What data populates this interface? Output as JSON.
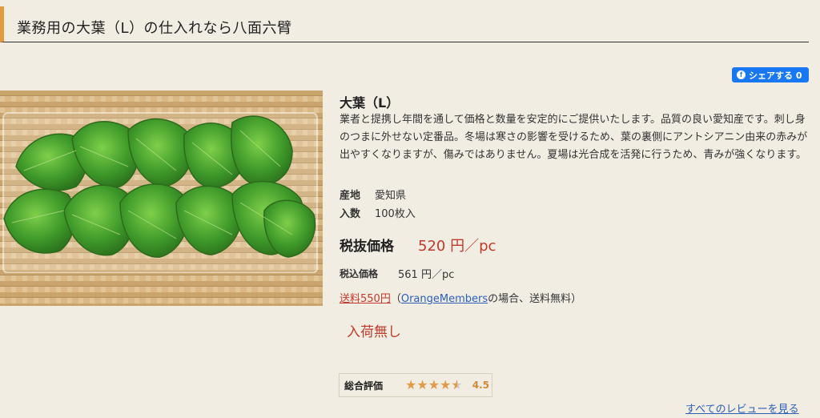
{
  "header": {
    "title": "業務用の大葉（L）の仕入れなら八面六臂"
  },
  "share": {
    "label": "シェアする 0",
    "icon": "facebook-icon",
    "color": "#1877f2"
  },
  "product": {
    "name": "大葉（L）",
    "description": "業者と提携し年間を通して価格と数量を安定的にご提供いたします。品質の良い愛知産です。刺し身のつまに外せない定番品。冬場は寒さの影響を受けるため、葉の裏側にアントシアニン由来の赤みが出やすくなりますが、傷みではありません。夏場は光合成を活発に行うため、青みが強くなります。",
    "origin_label": "産地",
    "origin_value": "愛知県",
    "quantity_label": "入数",
    "quantity_value": "100枚入",
    "price_label": "税抜価格",
    "price_value": "520 円／pc",
    "tax_price_label": "税込価格",
    "tax_price_value": "561 円／pc",
    "shipping_link": "送料550円",
    "shipping_open": "（",
    "members_link": "OrangeMembers",
    "shipping_note": "の場合、送料無料）",
    "stock_status": "入荷無し"
  },
  "rating": {
    "label": "総合評価",
    "value": "4.5",
    "stars_filled": 4.5,
    "stars_total": 5,
    "star_color": "#e09a48"
  },
  "reviews": {
    "all_link": "すべてのレビューを見る"
  },
  "colors": {
    "accent": "#e39a3c",
    "price": "#c0392b",
    "link": "#2a5fb8"
  }
}
